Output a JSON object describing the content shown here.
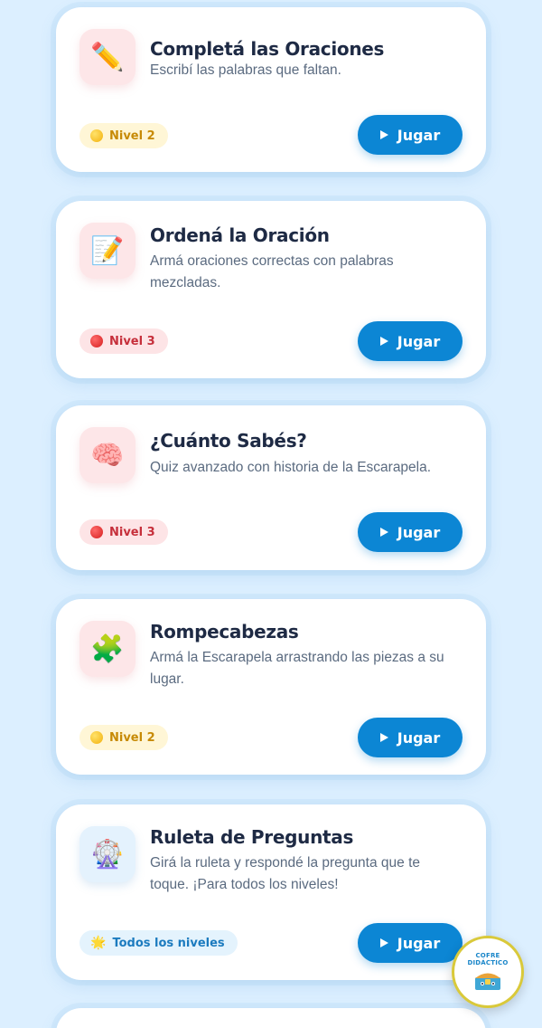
{
  "cards": [
    {
      "icon": "pencil-icon",
      "icon_glyph": "✏️",
      "title": "Completá las Oraciones",
      "description": "Escribí las palabras que faltan.",
      "level": "Nivel 2",
      "level_color": "yellow",
      "button": "Jugar"
    },
    {
      "icon": "memo-icon",
      "icon_glyph": "📝",
      "title": "Ordená la Oración",
      "description": "Armá oraciones correctas con palabras mezcladas.",
      "level": "Nivel 3",
      "level_color": "red",
      "button": "Jugar"
    },
    {
      "icon": "brain-icon",
      "icon_glyph": "🧠",
      "title": "¿Cuánto Sabés?",
      "description": "Quiz avanzado con historia de la Escarapela.",
      "level": "Nivel 3",
      "level_color": "red",
      "button": "Jugar"
    },
    {
      "icon": "puzzle-icon",
      "icon_glyph": "🧩",
      "title": "Rompecabezas",
      "description": "Armá la Escarapela arrastrando las piezas a su lugar.",
      "level": "Nivel 2",
      "level_color": "yellow",
      "button": "Jugar"
    },
    {
      "icon": "ferris-wheel-icon",
      "icon_glyph": "🎡",
      "title": "Ruleta de Preguntas",
      "description": "Girá la ruleta y respondé la pregunta que te toque. ¡Para todos los niveles!",
      "level": "Todos los niveles",
      "level_color": "blue",
      "level_icon_glyph": "🌟",
      "button": "Jugar"
    }
  ],
  "floating_badge": {
    "line1": "COFRE",
    "line2": "DIDÁCTICO"
  },
  "colors": {
    "background": "#dcefff",
    "accent": "#0c86d4",
    "title": "#1e2a44"
  }
}
